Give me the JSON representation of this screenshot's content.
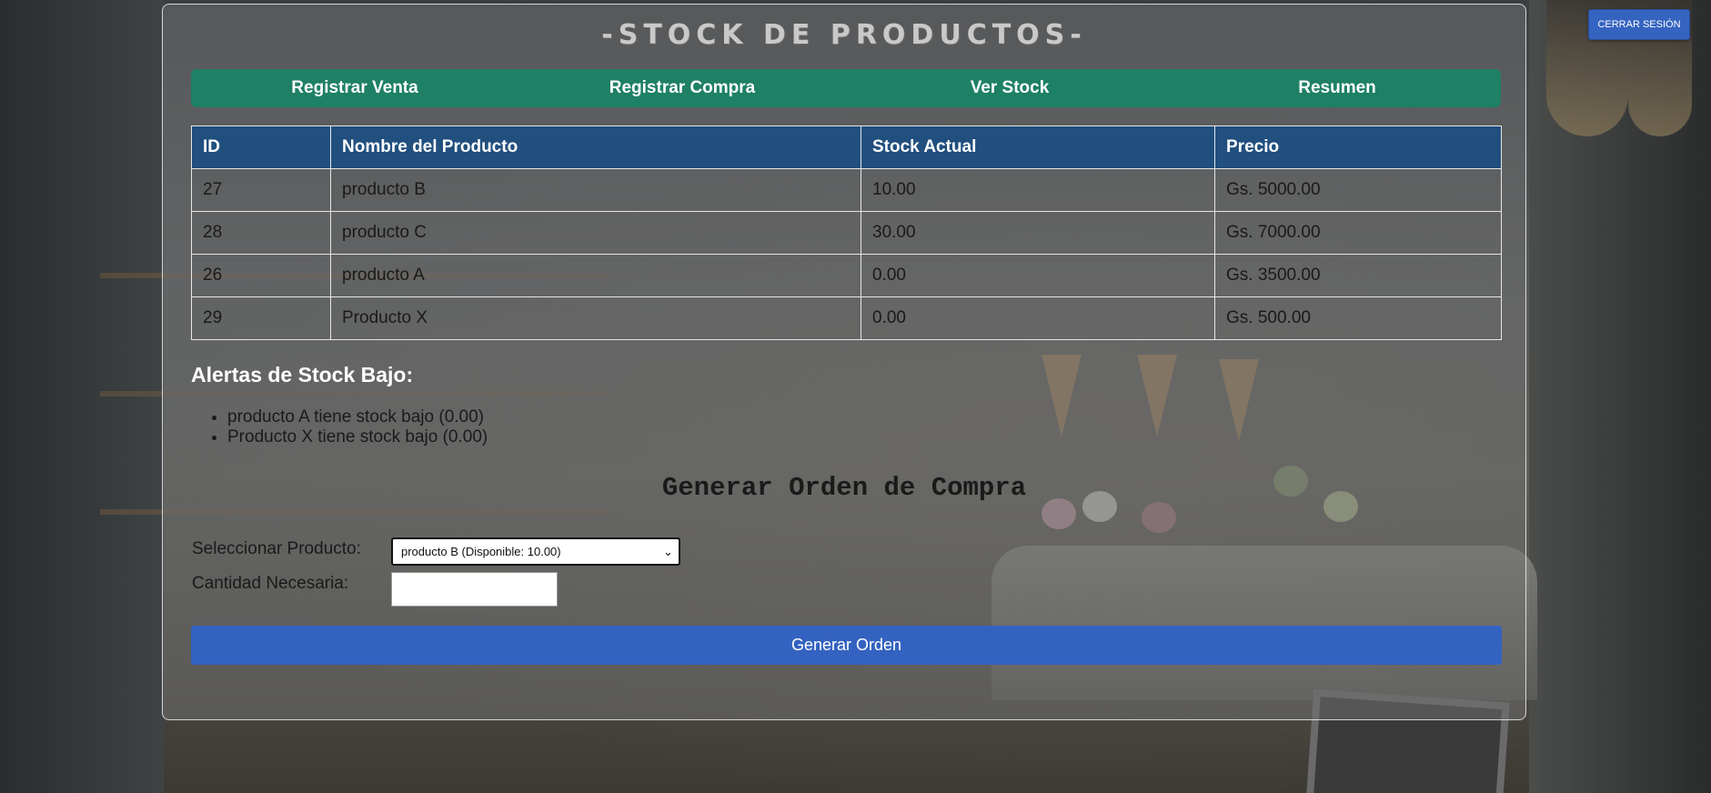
{
  "header": {
    "logout_label": "CERRAR SESIÓN"
  },
  "page": {
    "title": "-STOCK DE PRODUCTOS-"
  },
  "nav": {
    "items": [
      {
        "label": "Registrar Venta"
      },
      {
        "label": "Registrar Compra"
      },
      {
        "label": "Ver Stock"
      },
      {
        "label": "Resumen"
      }
    ]
  },
  "table": {
    "headers": [
      "ID",
      "Nombre del Producto",
      "Stock Actual",
      "Precio"
    ],
    "rows": [
      [
        "27",
        "producto B",
        "10.00",
        "Gs. 5000.00"
      ],
      [
        "28",
        "producto C",
        "30.00",
        "Gs. 7000.00"
      ],
      [
        "26",
        "producto A",
        "0.00",
        "Gs. 3500.00"
      ],
      [
        "29",
        "Producto X",
        "0.00",
        "Gs. 500.00"
      ]
    ]
  },
  "alerts": {
    "title": "Alertas de Stock Bajo:",
    "items": [
      "producto A tiene stock bajo (0.00)",
      "Producto X tiene stock bajo (0.00)"
    ]
  },
  "order_form": {
    "title": "Generar Orden de Compra",
    "product_label": "Seleccionar Producto:",
    "selected_product": "producto B (Disponible: 10.00)",
    "quantity_label": "Cantidad Necesaria:",
    "quantity_value": "",
    "submit_label": "Generar Orden"
  },
  "colors": {
    "nav_bg": "#1e8065",
    "table_header_bg": "#214f7e",
    "button_bg": "#3462c1"
  },
  "icons": {
    "select_chevron": "chevron-down-icon"
  }
}
